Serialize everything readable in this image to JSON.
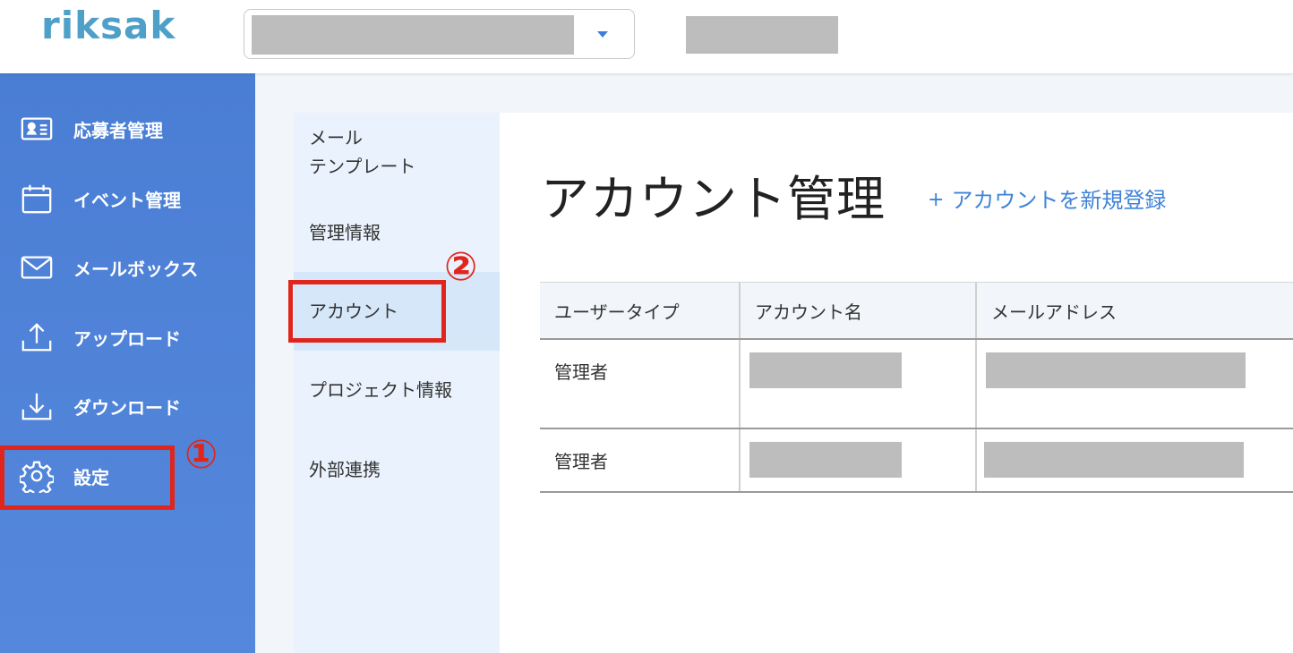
{
  "header": {
    "logo_text": "riksak"
  },
  "sidebar": {
    "items": [
      {
        "label": "応募者管理",
        "icon": "applicant-card-icon"
      },
      {
        "label": "イベント管理",
        "icon": "calendar-icon"
      },
      {
        "label": "メールボックス",
        "icon": "mail-icon"
      },
      {
        "label": "アップロード",
        "icon": "upload-icon"
      },
      {
        "label": "ダウンロード",
        "icon": "download-icon"
      },
      {
        "label": "設定",
        "icon": "gear-icon"
      }
    ]
  },
  "submenu": {
    "items": [
      {
        "label_line1": "メール",
        "label_line2": "テンプレート"
      },
      {
        "label": "管理情報"
      },
      {
        "label": "アカウント"
      },
      {
        "label": "プロジェクト情報"
      },
      {
        "label": "外部連携"
      }
    ],
    "active": "アカウント"
  },
  "main": {
    "title": "アカウント管理",
    "add_plus": "+",
    "add_link": "アカウントを新規登録",
    "table": {
      "columns": [
        "ユーザータイプ",
        "アカウント名",
        "メールアドレス"
      ],
      "rows": [
        {
          "user_type": "管理者"
        },
        {
          "user_type": "管理者"
        }
      ]
    }
  },
  "annotations": {
    "step1": "①",
    "step2": "②"
  },
  "colors": {
    "sidebar": "#4a7ed4",
    "link": "#3f83d6",
    "annotation": "#e0261c",
    "logo": "#4fa0c8"
  }
}
